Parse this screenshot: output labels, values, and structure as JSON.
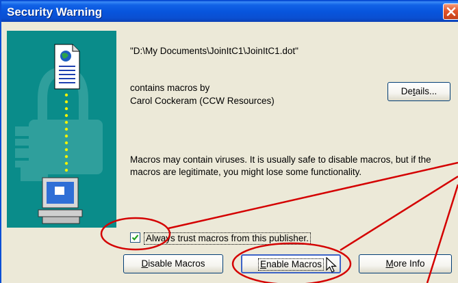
{
  "window": {
    "title": "Security Warning"
  },
  "dialog": {
    "file_path": "\"D:\\My Documents\\JoinItC1\\JoinItC1.dot\"",
    "contains_line": "contains macros by",
    "publisher_line": "Carol Cockeram (CCW Resources)",
    "warning_line1": "Macros may contain viruses. It is usually safe to disable macros, but if the",
    "warning_line2": "macros are legitimate, you might lose some functionality.",
    "checkbox_label": "Always trust macros from this publisher.",
    "checkbox_checked": true
  },
  "buttons": {
    "details": {
      "pre": "De",
      "u": "t",
      "post": "ails..."
    },
    "disable": {
      "pre": "",
      "u": "D",
      "post": "isable Macros"
    },
    "enable": {
      "pre": "",
      "u": "E",
      "post": "nable Macros"
    },
    "more_info": {
      "pre": "",
      "u": "M",
      "post": "ore Info"
    }
  },
  "colors": {
    "titlebar": "#0855dd",
    "dialog_bg": "#ece9d8",
    "side_panel": "#0a8c8a",
    "annotation": "#d40000"
  }
}
